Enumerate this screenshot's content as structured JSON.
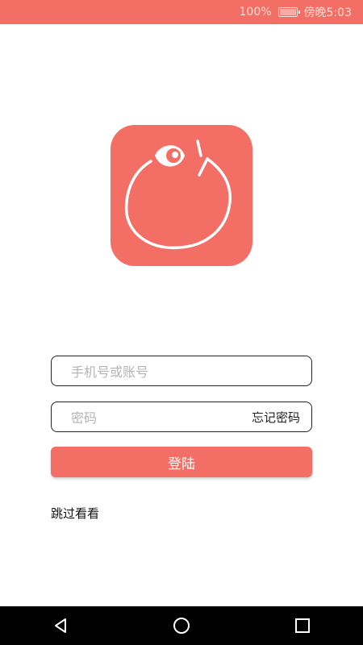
{
  "status_bar": {
    "battery": "100%",
    "time": "傍晚5:03"
  },
  "form": {
    "phone_placeholder": "手机号或账号",
    "password_placeholder": "密码",
    "forgot_password": "忘记密码",
    "login_label": "登陆",
    "skip_label": "跳过看看"
  },
  "colors": {
    "accent": "#f36e64"
  }
}
